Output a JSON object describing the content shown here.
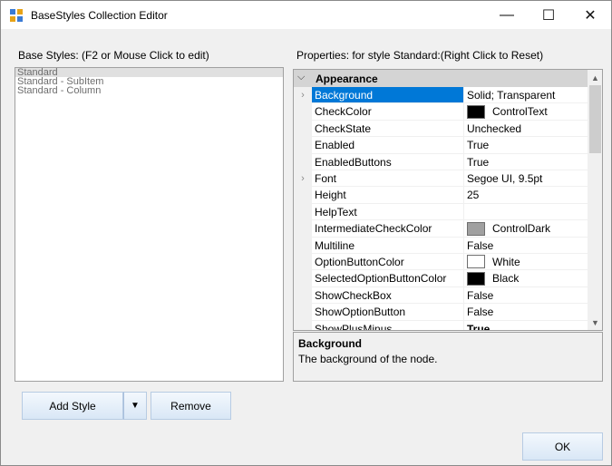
{
  "window": {
    "title": "BaseStyles Collection Editor"
  },
  "window_controls": {
    "minimize": "—",
    "maximize": "☐",
    "close": "✕"
  },
  "base_styles": {
    "label": "Base Styles: (F2 or Mouse Click to edit)",
    "items": [
      "Standard",
      "Standard - SubItem",
      "Standard - Column"
    ],
    "selected_index": 0
  },
  "properties": {
    "label": "Properties: for style Standard:(Right Click to Reset)",
    "category": "Appearance",
    "rows": [
      {
        "name": "Background",
        "value": "Solid; Transparent",
        "expandable": true,
        "selected": true
      },
      {
        "name": "CheckColor",
        "value": "ControlText",
        "swatch": "#000000"
      },
      {
        "name": "CheckState",
        "value": "Unchecked"
      },
      {
        "name": "Enabled",
        "value": "True"
      },
      {
        "name": "EnabledButtons",
        "value": "True"
      },
      {
        "name": "Font",
        "value": "Segoe UI, 9.5pt",
        "expandable": true
      },
      {
        "name": "Height",
        "value": "25"
      },
      {
        "name": "HelpText",
        "value": ""
      },
      {
        "name": "IntermediateCheckColor",
        "value": "ControlDark",
        "swatch": "#a0a0a0"
      },
      {
        "name": "Multiline",
        "value": "False"
      },
      {
        "name": "OptionButtonColor",
        "value": "White",
        "swatch": "#ffffff"
      },
      {
        "name": "SelectedOptionButtonColor",
        "value": "Black",
        "swatch": "#000000"
      },
      {
        "name": "ShowCheckBox",
        "value": "False"
      },
      {
        "name": "ShowOptionButton",
        "value": "False"
      },
      {
        "name": "ShowPlusMinus",
        "value": "True",
        "partial": true
      }
    ]
  },
  "help": {
    "title": "Background",
    "description": "The background of the node."
  },
  "buttons": {
    "add_style": "Add Style",
    "remove": "Remove",
    "ok": "OK"
  },
  "colors": {
    "selection": "#0078d7",
    "category_bg": "#d4d4d4",
    "button_bg": "#dbe8f7"
  }
}
